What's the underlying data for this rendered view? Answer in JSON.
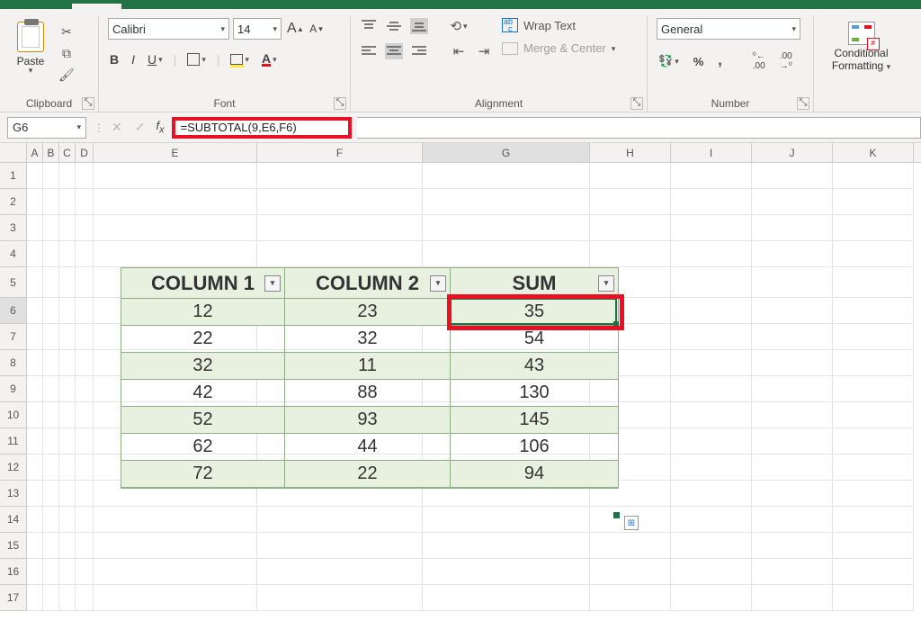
{
  "ribbon": {
    "clipboard": {
      "label": "Clipboard",
      "paste": "Paste"
    },
    "font": {
      "label": "Font",
      "name": "Calibri",
      "size": "14",
      "increase": "A",
      "decrease": "A",
      "bold": "B",
      "italic": "I",
      "underline": "U",
      "font_color_glyph": "A"
    },
    "alignment": {
      "label": "Alignment",
      "wrap": "Wrap Text",
      "merge": "Merge & Center"
    },
    "number": {
      "label": "Number",
      "format": "General",
      "percent": "%",
      "comma": ",",
      "inc_dec": ".0",
      "dec_dec": ".00"
    },
    "conditional": {
      "label1": "Conditional",
      "label2": "Formatting"
    }
  },
  "formula_bar": {
    "cell_ref": "G6",
    "formula": "=SUBTOTAL(9,E6,F6)"
  },
  "columns": [
    "A",
    "B",
    "C",
    "D",
    "E",
    "F",
    "G",
    "H",
    "I",
    "J",
    "K"
  ],
  "rows": [
    "1",
    "2",
    "3",
    "4",
    "5",
    "6",
    "7",
    "8",
    "9",
    "10",
    "11",
    "12",
    "13",
    "14",
    "15",
    "16",
    "17"
  ],
  "table": {
    "headers": [
      "COLUMN 1",
      "COLUMN 2",
      "SUM"
    ],
    "rows": [
      {
        "c1": "12",
        "c2": "23",
        "sum": "35"
      },
      {
        "c1": "22",
        "c2": "32",
        "sum": "54"
      },
      {
        "c1": "32",
        "c2": "11",
        "sum": "43"
      },
      {
        "c1": "42",
        "c2": "88",
        "sum": "130"
      },
      {
        "c1": "52",
        "c2": "93",
        "sum": "145"
      },
      {
        "c1": "62",
        "c2": "44",
        "sum": "106"
      },
      {
        "c1": "72",
        "c2": "22",
        "sum": "94"
      }
    ]
  }
}
